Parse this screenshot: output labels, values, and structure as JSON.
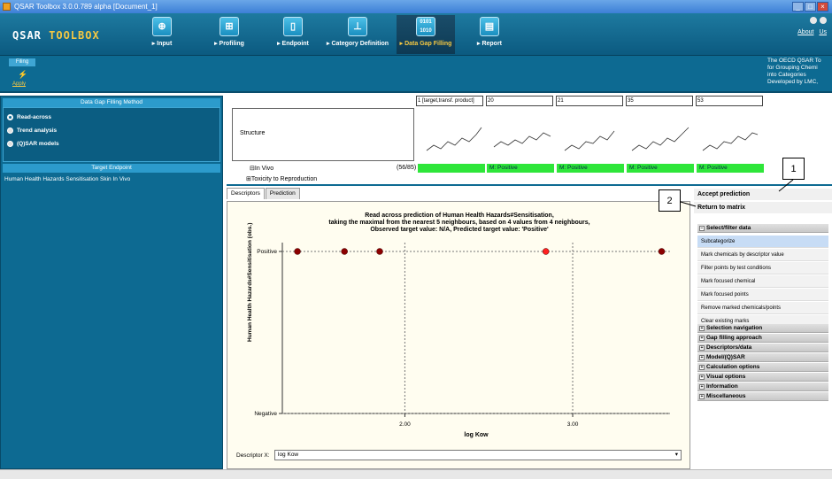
{
  "window": {
    "title": "QSAR Toolbox 3.0.0.789 alpha [Document_1]"
  },
  "ribbon": {
    "logo_a": "QSAR ",
    "logo_b": "TOOLBOX",
    "nav": [
      {
        "label": "▸ Input"
      },
      {
        "label": "▸ Profiling"
      },
      {
        "label": "▸ Endpoint"
      },
      {
        "label": "▸ Category Definition"
      },
      {
        "label": "▸ Data Gap Filling"
      },
      {
        "label": "▸ Report"
      }
    ],
    "about": "About",
    "us": "Us"
  },
  "subribbon": {
    "filing": "Filing",
    "apply": "Apply",
    "oecd_1": "The OECD QSAR To",
    "oecd_2": "for Grouping Chemi",
    "oecd_3": "into Categories",
    "oecd_4": "Developed by LMC,"
  },
  "leftpanel": {
    "method_header": "Data Gap Filling Method",
    "methods": [
      "Read-across",
      "Trend analysis",
      "(Q)SAR models"
    ],
    "endpoint_header": "Target Endpoint",
    "endpoint": "Human Health Hazards Sensitisation Skin In Vivo"
  },
  "matrix": {
    "columns": [
      "1 [target,transf. product]",
      "20",
      "21",
      "35",
      "53"
    ],
    "structure_label": "Structure",
    "in_vivo": "In Vivo",
    "in_vivo_count": "(56/85)",
    "toxicity": "Toxicity to Reproduction",
    "values": [
      "M: Positive",
      "M: Positive",
      "M: Positive",
      "M: Positive"
    ]
  },
  "tabs": [
    "Descriptors",
    "Prediction"
  ],
  "chart_data": {
    "type": "scatter",
    "title_1": "Read across prediction of Human Health Hazards#Sensitisation,",
    "title_2": "taking the maximal from the nearest 5 neighbours, based on 4 values from 4 neighbours,",
    "title_3": "Observed target value: N/A, Predicted target value: 'Positive'",
    "xlabel": "log Kow",
    "ylabel": "Human Health Hazards#Sensitisation (obs.)",
    "y_categories": [
      "Negative",
      "Positive"
    ],
    "x_ticks": [
      2.0,
      3.0
    ],
    "x_tick_labels": [
      "2.00",
      "3.00"
    ],
    "xlim": [
      1.27,
      3.58
    ],
    "points": [
      {
        "x": 1.36,
        "y": "Positive",
        "role": "neighbour"
      },
      {
        "x": 1.64,
        "y": "Positive",
        "role": "neighbour"
      },
      {
        "x": 1.85,
        "y": "Positive",
        "role": "neighbour"
      },
      {
        "x": 2.84,
        "y": "Positive",
        "role": "target"
      },
      {
        "x": 3.53,
        "y": "Positive",
        "role": "neighbour"
      }
    ],
    "colors": {
      "neighbour": "#8b0000",
      "target": "#ff2020"
    }
  },
  "descriptor": {
    "label": "Descriptor X:",
    "value": "log Kow"
  },
  "rightpanel": {
    "accept": "Accept prediction",
    "return": "Return to matrix",
    "select_header": "Select/filter data",
    "items": [
      "Subcategorize",
      "Mark chemicals by descriptor value",
      "Filter points by test conditions",
      "Mark focused chemical",
      "Mark focused points",
      "Remove marked chemicals/points",
      "Clear existing marks"
    ],
    "sections": [
      "Selection navigation",
      "Gap filling approach",
      "Descriptors/data",
      "Model/(Q)SAR",
      "Calculation options",
      "Visual options",
      "Information",
      "Miscellaneous"
    ]
  },
  "callouts": [
    "1",
    "2"
  ]
}
